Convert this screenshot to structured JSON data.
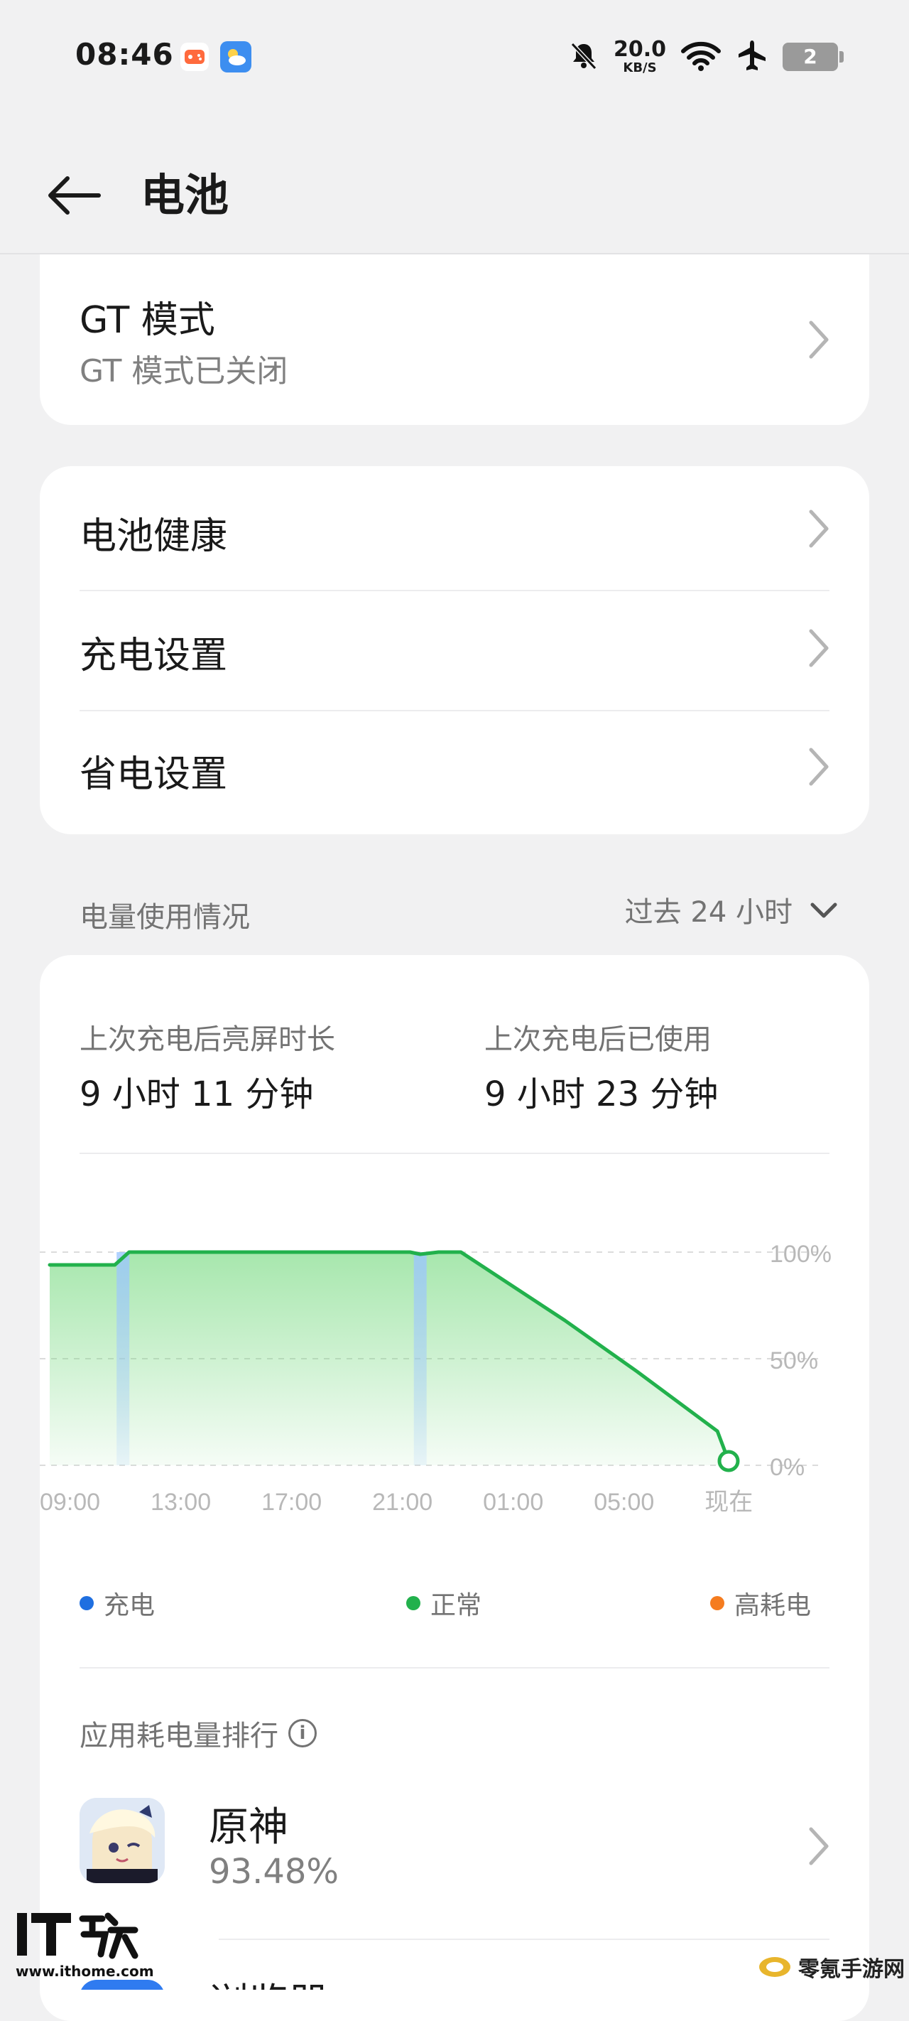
{
  "status_bar": {
    "time": "08:46",
    "net_speed": "20.0",
    "net_unit": "KB/S",
    "battery": "2"
  },
  "header": {
    "title": "电池"
  },
  "gt_card": {
    "title": "GT 模式",
    "subtitle": "GT 模式已关闭"
  },
  "menu": {
    "items": [
      {
        "label": "电池健康"
      },
      {
        "label": "充电设置"
      },
      {
        "label": "省电设置"
      }
    ]
  },
  "usage": {
    "section_title": "电量使用情况",
    "range_label": "过去 24 小时",
    "screen_on_label": "上次充电后亮屏时长",
    "screen_on_value": "9 小时 11 分钟",
    "used_label": "上次充电后已使用",
    "used_value": "9 小时 23 分钟"
  },
  "chart_data": {
    "type": "area",
    "x_ticks": [
      "09:00",
      "13:00",
      "17:00",
      "21:00",
      "01:00",
      "05:00",
      "现在"
    ],
    "y_ticks": [
      "100%",
      "50%",
      "0%"
    ],
    "ylim": [
      0,
      100
    ],
    "grid": true,
    "series": [
      {
        "name": "正常",
        "color": "#22b14c",
        "x_hours": [
          0,
          6.4,
          7.8,
          35.4,
          36.4,
          38.2,
          40.4,
          50.6,
          57.7,
          65.6,
          66.7
        ],
        "values": [
          94,
          94,
          100,
          100,
          99,
          100,
          100,
          68,
          44,
          16,
          2
        ]
      }
    ],
    "charging_marks_hours": [
      7.2,
      36.4
    ],
    "x_span_hours": [
      0,
      66.7
    ]
  },
  "legend": {
    "charging": {
      "label": "充电",
      "color": "#1f6fe0"
    },
    "normal": {
      "label": "正常",
      "color": "#22b14c"
    },
    "high": {
      "label": "高耗电",
      "color": "#f57c1f"
    }
  },
  "ranking": {
    "title": "应用耗电量排行",
    "apps": [
      {
        "name": "原神",
        "percent": "93.48%"
      },
      {
        "name": "浏览器",
        "percent": ""
      }
    ]
  },
  "watermark": {
    "left_url": "www.ithome.com",
    "right_text": "零氪手游网"
  }
}
